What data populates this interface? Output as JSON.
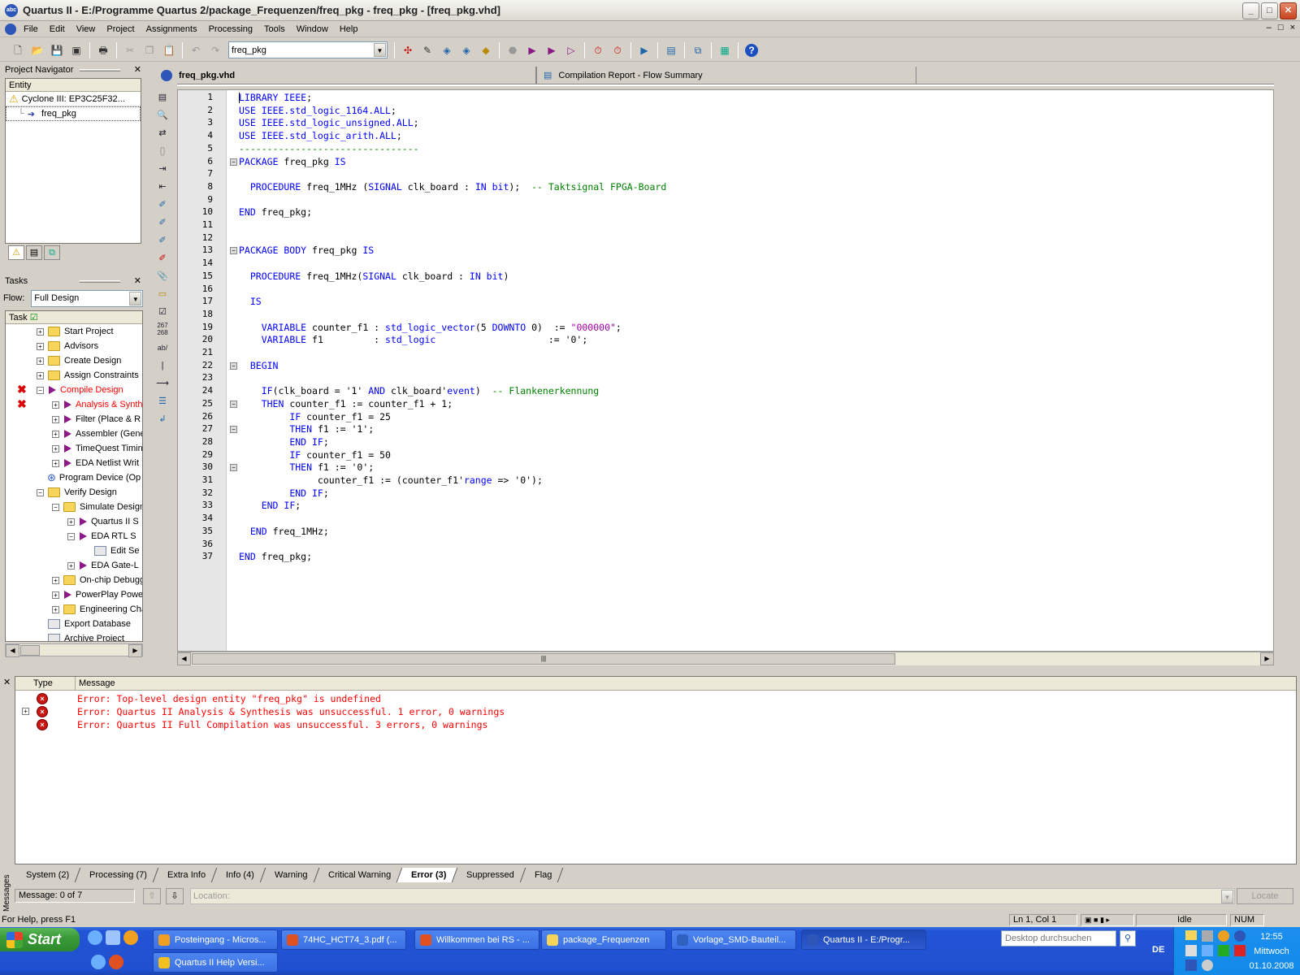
{
  "window": {
    "title": "Quartus II - E:/Programme Quartus 2/package_Frequenzen/freq_pkg - freq_pkg - [freq_pkg.vhd]",
    "min": "_",
    "max": "□",
    "close": "✕"
  },
  "menu": [
    "File",
    "Edit",
    "View",
    "Project",
    "Assignments",
    "Processing",
    "Tools",
    "Window",
    "Help"
  ],
  "mdi_controls": [
    "–",
    "□",
    "×"
  ],
  "toolbar": {
    "entity_combo": "freq_pkg"
  },
  "navigator": {
    "title": "Project Navigator",
    "column": "Entity",
    "device": "Cyclone III: EP3C25F32...",
    "entity": "freq_pkg"
  },
  "tasks": {
    "title": "Tasks",
    "flow_label": "Flow:",
    "flow_value": "Full Design",
    "column": "Task",
    "items": [
      {
        "label": "Start Project",
        "indent": 0,
        "type": "folder",
        "pm": "+",
        "state": "normal"
      },
      {
        "label": "Advisors",
        "indent": 0,
        "type": "folder",
        "pm": "+",
        "state": "normal"
      },
      {
        "label": "Create Design",
        "indent": 0,
        "type": "folder",
        "pm": "+",
        "state": "normal"
      },
      {
        "label": "Assign Constraints",
        "indent": 0,
        "type": "folder",
        "pm": "+",
        "state": "normal"
      },
      {
        "label": "Compile Design",
        "indent": 0,
        "type": "run",
        "pm": "−",
        "state": "error"
      },
      {
        "label": "Analysis & Synth",
        "indent": 1,
        "type": "run",
        "pm": "+",
        "state": "error"
      },
      {
        "label": "Filter (Place & R",
        "indent": 1,
        "type": "run",
        "pm": "+",
        "state": "normal"
      },
      {
        "label": "Assembler (Gene",
        "indent": 1,
        "type": "run",
        "pm": "+",
        "state": "normal"
      },
      {
        "label": "TimeQuest Timin",
        "indent": 1,
        "type": "run",
        "pm": "+",
        "state": "normal"
      },
      {
        "label": "EDA Netlist Writ",
        "indent": 1,
        "type": "run",
        "pm": "+",
        "state": "normal"
      },
      {
        "label": "Program Device (Op",
        "indent": 0,
        "type": "device",
        "pm": "",
        "state": "normal"
      },
      {
        "label": "Verify Design",
        "indent": 0,
        "type": "folder",
        "pm": "−",
        "state": "normal"
      },
      {
        "label": "Simulate Design",
        "indent": 1,
        "type": "folder",
        "pm": "−",
        "state": "normal"
      },
      {
        "label": "Quartus II S",
        "indent": 2,
        "type": "run",
        "pm": "+",
        "state": "normal"
      },
      {
        "label": "EDA RTL S",
        "indent": 2,
        "type": "run",
        "pm": "−",
        "state": "normal"
      },
      {
        "label": "Edit Se",
        "indent": 3,
        "type": "doc",
        "pm": "",
        "state": "normal"
      },
      {
        "label": "EDA Gate-L",
        "indent": 2,
        "type": "run",
        "pm": "+",
        "state": "normal"
      },
      {
        "label": "On-chip Debugg",
        "indent": 1,
        "type": "folder",
        "pm": "+",
        "state": "normal"
      },
      {
        "label": "PowerPlay Powe",
        "indent": 1,
        "type": "run",
        "pm": "+",
        "state": "normal"
      },
      {
        "label": "Engineering Cha",
        "indent": 1,
        "type": "folder",
        "pm": "+",
        "state": "normal"
      },
      {
        "label": "Export Database",
        "indent": 0,
        "type": "doc",
        "pm": "",
        "state": "normal"
      },
      {
        "label": "Archive Project",
        "indent": 0,
        "type": "doc",
        "pm": "",
        "state": "normal"
      }
    ]
  },
  "tabs": [
    {
      "label": "freq_pkg.vhd",
      "active": true
    },
    {
      "label": "Compilation Report - Flow Summary",
      "active": false
    }
  ],
  "code_lines": [
    [
      [
        "kw",
        "LIBRARY IEEE"
      ],
      [
        "",
        "; "
      ]
    ],
    [
      [
        "kw",
        "USE IEEE.std_logic_1164.ALL"
      ],
      [
        "",
        ";"
      ]
    ],
    [
      [
        "kw",
        "USE IEEE.std_logic_unsigned.ALL"
      ],
      [
        "",
        ";"
      ]
    ],
    [
      [
        "kw",
        "USE IEEE.std_logic_arith.ALL"
      ],
      [
        "",
        ";"
      ]
    ],
    [
      [
        "cm",
        "--------------------------------"
      ]
    ],
    [
      [
        "kw",
        "PACKAGE"
      ],
      [
        "",
        " freq_pkg "
      ],
      [
        "kw",
        "IS"
      ]
    ],
    [],
    [
      [
        "",
        "  "
      ],
      [
        "kw",
        "PROCEDURE"
      ],
      [
        "",
        " freq_1MHz ("
      ],
      [
        "kw",
        "SIGNAL"
      ],
      [
        "",
        " clk_board : "
      ],
      [
        "kw",
        "IN bit"
      ],
      [
        "",
        ");  "
      ],
      [
        "cm",
        "-- Taktsignal FPGA-Board"
      ]
    ],
    [],
    [
      [
        "kw",
        "END"
      ],
      [
        "",
        " freq_pkg;"
      ]
    ],
    [],
    [],
    [
      [
        "kw",
        "PACKAGE BODY"
      ],
      [
        "",
        " freq_pkg "
      ],
      [
        "kw",
        "IS"
      ]
    ],
    [],
    [
      [
        "",
        "  "
      ],
      [
        "kw",
        "PROCEDURE"
      ],
      [
        "",
        " freq_1MHz("
      ],
      [
        "kw",
        "SIGNAL"
      ],
      [
        "",
        " clk_board : "
      ],
      [
        "kw",
        "IN bit"
      ],
      [
        "",
        ")"
      ]
    ],
    [],
    [
      [
        "",
        "  "
      ],
      [
        "kw",
        "IS"
      ]
    ],
    [],
    [
      [
        "",
        "    "
      ],
      [
        "kw",
        "VARIABLE"
      ],
      [
        "",
        " counter_f1 : "
      ],
      [
        "kw",
        "std_logic_vector"
      ],
      [
        "",
        "(5 "
      ],
      [
        "kw",
        "DOWNTO"
      ],
      [
        "",
        " 0)  := "
      ],
      [
        "st",
        "\"000000\""
      ],
      [
        "",
        ";"
      ]
    ],
    [
      [
        "",
        "    "
      ],
      [
        "kw",
        "VARIABLE"
      ],
      [
        "",
        " f1         : "
      ],
      [
        "kw",
        "std_logic"
      ],
      [
        "",
        "                    := '0';"
      ]
    ],
    [],
    [
      [
        "",
        "  "
      ],
      [
        "kw",
        "BEGIN"
      ]
    ],
    [],
    [
      [
        "",
        "    "
      ],
      [
        "kw",
        "IF"
      ],
      [
        "",
        "(clk_board = '1' "
      ],
      [
        "kw",
        "AND"
      ],
      [
        "",
        " clk_board'"
      ],
      [
        "kw",
        "event"
      ],
      [
        "",
        ")  "
      ],
      [
        "cm",
        "-- Flankenerkennung"
      ]
    ],
    [
      [
        "",
        "    "
      ],
      [
        "kw",
        "THEN"
      ],
      [
        "",
        " counter_f1 := counter_f1 + 1;"
      ]
    ],
    [
      [
        "",
        "         "
      ],
      [
        "kw",
        "IF"
      ],
      [
        "",
        " counter_f1 = 25"
      ]
    ],
    [
      [
        "",
        "         "
      ],
      [
        "kw",
        "THEN"
      ],
      [
        "",
        " f1 := '1';"
      ]
    ],
    [
      [
        "",
        "         "
      ],
      [
        "kw",
        "END IF"
      ],
      [
        "",
        ";"
      ]
    ],
    [
      [
        "",
        "         "
      ],
      [
        "kw",
        "IF"
      ],
      [
        "",
        " counter_f1 = 50"
      ]
    ],
    [
      [
        "",
        "         "
      ],
      [
        "kw",
        "THEN"
      ],
      [
        "",
        " f1 := '0';"
      ]
    ],
    [
      [
        "",
        "              counter_f1 := (counter_f1'"
      ],
      [
        "kw",
        "range"
      ],
      [
        "",
        " => '0');"
      ]
    ],
    [
      [
        "",
        "         "
      ],
      [
        "kw",
        "END IF"
      ],
      [
        "",
        ";"
      ]
    ],
    [
      [
        "",
        "    "
      ],
      [
        "kw",
        "END IF"
      ],
      [
        "",
        ";"
      ]
    ],
    [],
    [
      [
        "",
        "  "
      ],
      [
        "kw",
        "END"
      ],
      [
        "",
        " freq_1MHz;"
      ]
    ],
    [],
    [
      [
        "kw",
        "END"
      ],
      [
        "",
        " freq_pkg;"
      ]
    ]
  ],
  "fold_markers": [
    6,
    13,
    22,
    25,
    27,
    30
  ],
  "messages": {
    "col_type": "Type",
    "col_message": "Message",
    "rows": [
      {
        "text": "Error: Top-level design entity \"freq_pkg\" is undefined",
        "expand": false
      },
      {
        "text": "Error: Quartus II Analysis & Synthesis was unsuccessful. 1 error, 0 warnings",
        "expand": true
      },
      {
        "text": "Error: Quartus II Full Compilation was unsuccessful. 3 errors, 0 warnings",
        "expand": false
      }
    ],
    "tabs": [
      {
        "label": "System (2)",
        "active": false
      },
      {
        "label": "Processing (7)",
        "active": false
      },
      {
        "label": "Extra Info",
        "active": false
      },
      {
        "label": "Info (4)",
        "active": false
      },
      {
        "label": "Warning",
        "active": false
      },
      {
        "label": "Critical Warning",
        "active": false
      },
      {
        "label": "Error (3)",
        "active": true
      },
      {
        "label": "Suppressed",
        "active": false
      },
      {
        "label": "Flag",
        "active": false
      }
    ],
    "side_label": "Messages",
    "count": "Message: 0 of 7",
    "location_placeholder": "Location:",
    "locate": "Locate"
  },
  "statusbar": {
    "help": "For Help, press F1",
    "position": "Ln 1, Col 1",
    "state": "Idle",
    "num": "NUM"
  },
  "taskbar": {
    "start": "Start",
    "buttons_row1": [
      {
        "label": "Posteingang - Micros...",
        "color": "#f0a020",
        "active": false
      },
      {
        "label": "74HC_HCT74_3.pdf (...",
        "color": "#e05020",
        "active": false
      },
      {
        "label": "Willkommen bei RS - ...",
        "color": "#e05020",
        "active": false
      },
      {
        "label": "package_Frequenzen",
        "color": "#f7d45a",
        "active": false
      },
      {
        "label": "Vorlage_SMD-Bauteil...",
        "color": "#3060c0",
        "active": false
      },
      {
        "label": "Quartus II - E:/Progr...",
        "color": "#2d56b8",
        "active": true
      }
    ],
    "buttons_row2": [
      {
        "label": "Quartus II Help Versi...",
        "color": "#f0c020",
        "active": false
      }
    ],
    "search_placeholder": "Desktop durchsuchen",
    "lang": "DE",
    "time": "12:55",
    "day": "Mittwoch",
    "date": "01.10.2008"
  }
}
